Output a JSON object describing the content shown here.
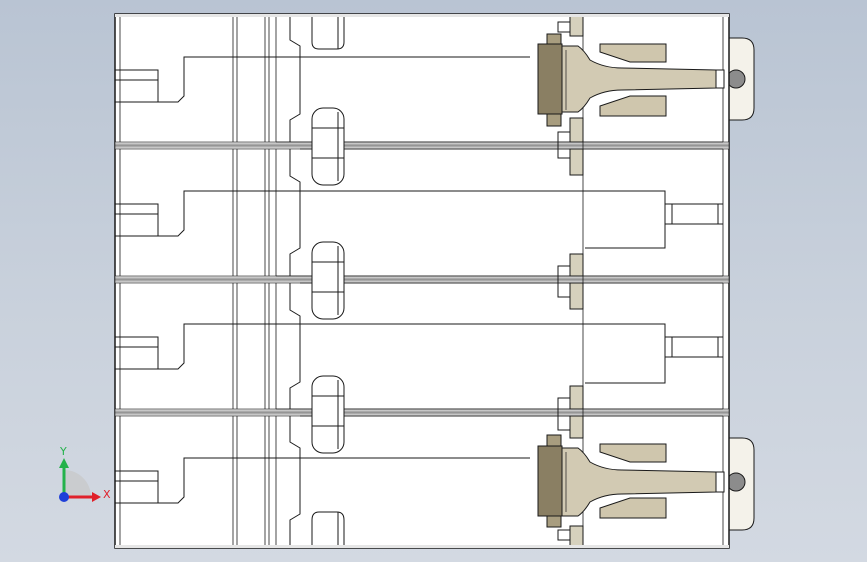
{
  "viewport": {
    "colors": {
      "background_top": "#b9c4d3",
      "background_bottom": "#d3d9e2",
      "part_fill": "#ffffff",
      "edge": "#1a1a1a",
      "shaded_fill": "#d8d0b8",
      "dark_fill": "#8a7f63",
      "seam": "#9a9a9a"
    }
  },
  "triad": {
    "x_label": "X",
    "y_label": "Y",
    "x_color": "#e0202a",
    "y_color": "#24b24b",
    "z_color": "#1e3fd8"
  }
}
